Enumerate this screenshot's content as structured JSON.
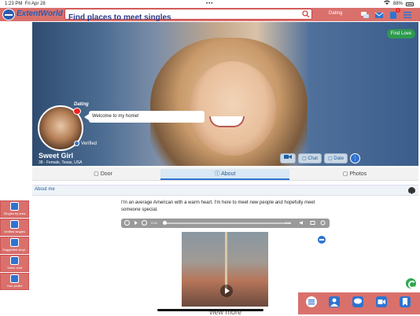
{
  "status_bar": {
    "time": "1:23 PM",
    "date": "Fri Apr 28",
    "dots": "•••",
    "battery": "88%"
  },
  "header": {
    "brand": "ExtentWorld",
    "search_placeholder": "Find places to meet singles",
    "dating_link": "Dating"
  },
  "hero": {
    "find_love": "Find Love",
    "dating_tag": "Dating",
    "bubble_text": "Welcome to my home!",
    "verified": "Verified",
    "name": "Sweet Girl",
    "details": "38 - Female, Texas, USA",
    "buttons": {
      "chat": "Chat",
      "date": "Date"
    }
  },
  "tabs": [
    {
      "label": "Door"
    },
    {
      "label": "About",
      "active": true
    },
    {
      "label": "Photos"
    }
  ],
  "about": {
    "section_title": "About me",
    "text": "I'm an average American with a warm heart. I'm here to meet new people and hopefully meet someone special.",
    "player": {
      "current": "0:00",
      "duration": "4:54"
    },
    "view_more": "view more"
  },
  "left_nav": [
    {
      "label": "Singles by area",
      "icon": "location-pin-icon"
    },
    {
      "label": "Verified singles",
      "icon": "verified-check-icon"
    },
    {
      "label": "Suggested singl..",
      "icon": "suggested-icon"
    },
    {
      "label": "Video chat",
      "icon": "video-icon"
    },
    {
      "label": "Your profile",
      "icon": "home-icon"
    }
  ],
  "badges": {
    "notifications": "1"
  },
  "colors": {
    "accent": "#d9706c",
    "blue": "#2f73d0",
    "green": "#2e9a4e"
  }
}
